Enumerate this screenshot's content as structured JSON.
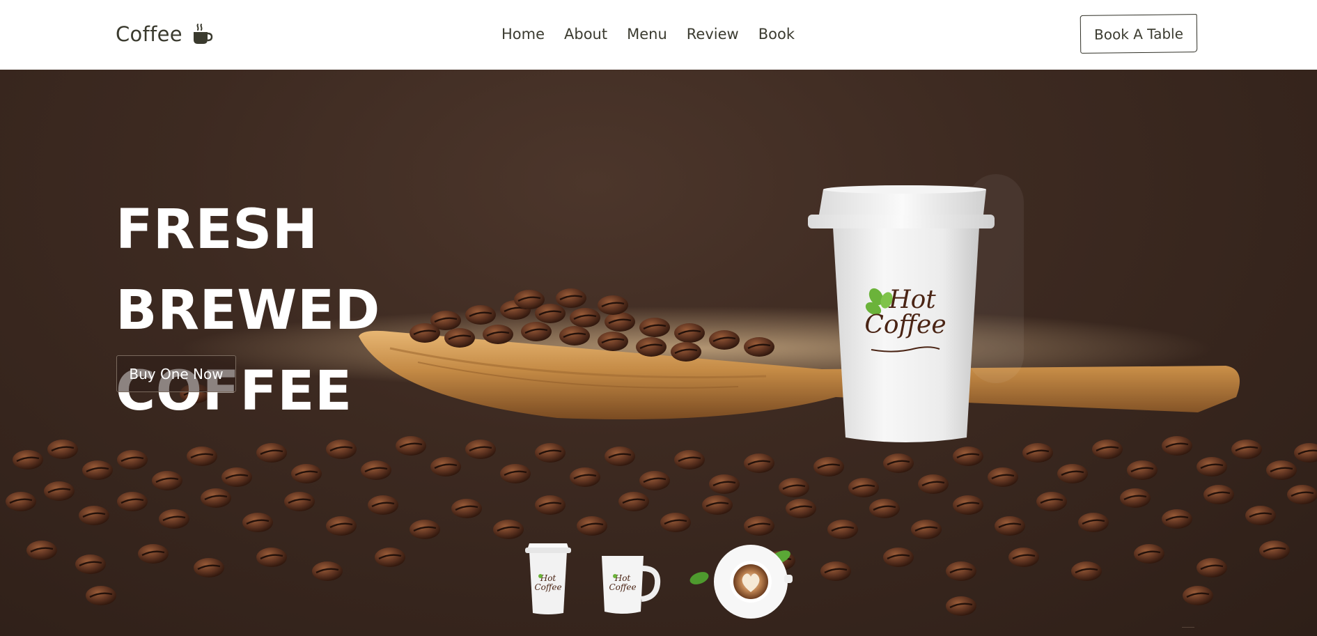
{
  "header": {
    "logo_text": "Coffee",
    "logo_icon": "coffee-cup-icon",
    "nav": [
      {
        "label": "Home"
      },
      {
        "label": "About"
      },
      {
        "label": "Menu"
      },
      {
        "label": "Review"
      },
      {
        "label": "Book"
      }
    ],
    "book_button_label": "Book A Table"
  },
  "hero": {
    "headline_line1": "FRESH BREWED",
    "headline_line2": "COFFEE",
    "cta_label": "Buy One Now",
    "cup_logo_line1": "Hot",
    "cup_logo_line2": "Coffee",
    "thumbnails": [
      {
        "name": "paper-cup-thumbnail",
        "logo": "Hot Coffee"
      },
      {
        "name": "mug-thumbnail",
        "logo": "Hot Coffee"
      },
      {
        "name": "latte-art-cup-thumbnail"
      }
    ]
  },
  "colors": {
    "background_dark": "#3d2a21",
    "text_dark": "#3b3b30",
    "bean_brown": "#5a3320",
    "logo_green": "#6bb33a"
  }
}
